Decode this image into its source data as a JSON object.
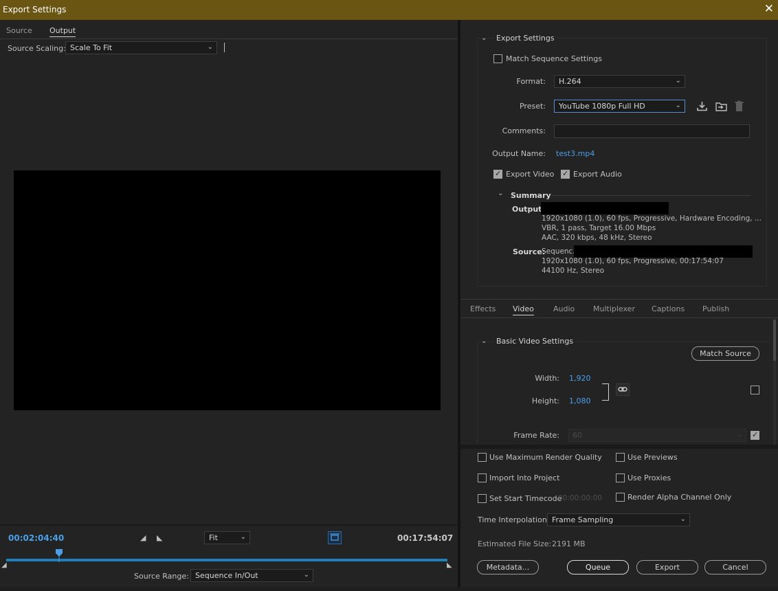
{
  "window": {
    "title": "Export Settings",
    "close_glyph": "✕"
  },
  "left": {
    "tabs": [
      "Source",
      "Output"
    ],
    "source_scaling_label": "Source Scaling:",
    "source_scaling_value": "Scale To Fit",
    "current_time": "00:02:04:40",
    "fit_value": "Fit",
    "end_time": "00:17:54:07",
    "source_range_label": "Source Range:",
    "source_range_value": "Sequence In/Out",
    "playhead_fraction": 0.12
  },
  "export_settings": {
    "section_title": "Export Settings",
    "match_sequence_label": "Match Sequence Settings",
    "match_sequence_checked": false,
    "format_label": "Format:",
    "format_value": "H.264",
    "preset_label": "Preset:",
    "preset_value": "YouTube 1080p Full HD",
    "comments_label": "Comments:",
    "comments_value": "",
    "output_name_label": "Output Name:",
    "output_name_value": "test3.mp4",
    "export_video_label": "Export Video",
    "export_video_checked": true,
    "export_audio_label": "Export Audio",
    "export_audio_checked": true,
    "icons": [
      "save-preset-icon",
      "import-preset-icon",
      "delete-preset-icon"
    ]
  },
  "summary": {
    "title": "Summary",
    "output_label": "Output:",
    "output_lines": [
      "1920x1080 (1.0), 60 fps, Progressive, Hardware Encoding, ...",
      "VBR, 1 pass, Target 16.00 Mbps",
      "AAC, 320 kbps, 48 kHz, Stereo"
    ],
    "source_label": "Source:",
    "source_prefix": "Sequenc..",
    "source_lines": [
      "1920x1080 (1.0), 60 fps, Progressive, 00:17:54:07",
      "44100 Hz, Stereo"
    ]
  },
  "settings_tabs": [
    "Effects",
    "Video",
    "Audio",
    "Multiplexer",
    "Captions",
    "Publish"
  ],
  "active_settings_tab": "Video",
  "video": {
    "section_title": "Basic Video Settings",
    "match_source_label": "Match Source",
    "width_label": "Width:",
    "width_value": "1,920",
    "height_label": "Height:",
    "height_value": "1,080",
    "frame_rate_label": "Frame Rate:",
    "frame_rate_value": "60",
    "dimension_checkbox_checked": false,
    "frame_rate_checkbox_checked": true
  },
  "options": {
    "max_render_quality_label": "Use Maximum Render Quality",
    "use_previews_label": "Use Previews",
    "import_into_project_label": "Import Into Project",
    "use_proxies_label": "Use Proxies",
    "set_start_timecode_label": "Set Start Timecode",
    "start_timecode_value": "00:00:00:00",
    "render_alpha_label": "Render Alpha Channel Only",
    "time_interpolation_label": "Time Interpolation:",
    "time_interpolation_value": "Frame Sampling",
    "file_size_label": "Estimated File Size:",
    "file_size_value": "2191 MB"
  },
  "buttons": {
    "metadata": "Metadata...",
    "queue": "Queue",
    "export": "Export",
    "cancel": "Cancel"
  },
  "colors": {
    "titlebar": "#6a5513",
    "accent_blue": "#4a9fe8",
    "timeline_track": "#1f7fb8"
  }
}
